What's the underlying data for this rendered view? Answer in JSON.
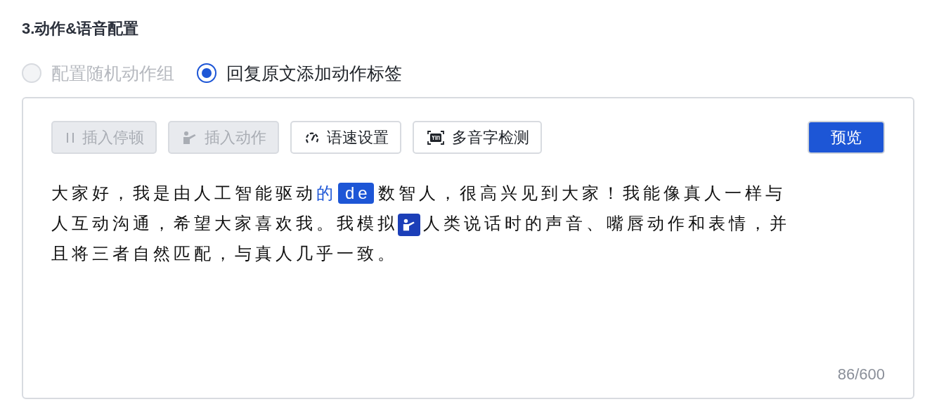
{
  "section_title": "3.动作&语音配置",
  "radios": [
    {
      "label": "配置随机动作组",
      "selected": false,
      "disabled": true
    },
    {
      "label": "回复原文添加动作标签",
      "selected": true,
      "disabled": false
    }
  ],
  "toolbar": [
    {
      "label": "插入停顿",
      "kind": "pause",
      "disabled": true
    },
    {
      "label": "插入动作",
      "kind": "gesture",
      "disabled": true
    },
    {
      "label": "语速设置",
      "kind": "gauge",
      "disabled": false
    },
    {
      "label": "多音字检测",
      "kind": "pinyin",
      "disabled": false
    }
  ],
  "preview_button": "预览",
  "content": [
    [
      {
        "kind": "text",
        "text": "大家好，我是由人工智能驱动"
      },
      {
        "kind": "polyphone",
        "text": "的"
      },
      {
        "kind": "pinyin",
        "text": "de"
      },
      {
        "kind": "text",
        "text": "数智人，很高兴见到大家！我能像真人一样与"
      }
    ],
    [
      {
        "kind": "text",
        "text": "人互动沟通，希望大家喜欢我。我模拟"
      },
      {
        "kind": "action"
      },
      {
        "kind": "text",
        "text": "人类说话时的声音、嘴唇动作和表情，并"
      }
    ],
    [
      {
        "kind": "text",
        "text": "且将三者自然匹配，与真人几乎一致。"
      }
    ]
  ],
  "counter": "86/600"
}
